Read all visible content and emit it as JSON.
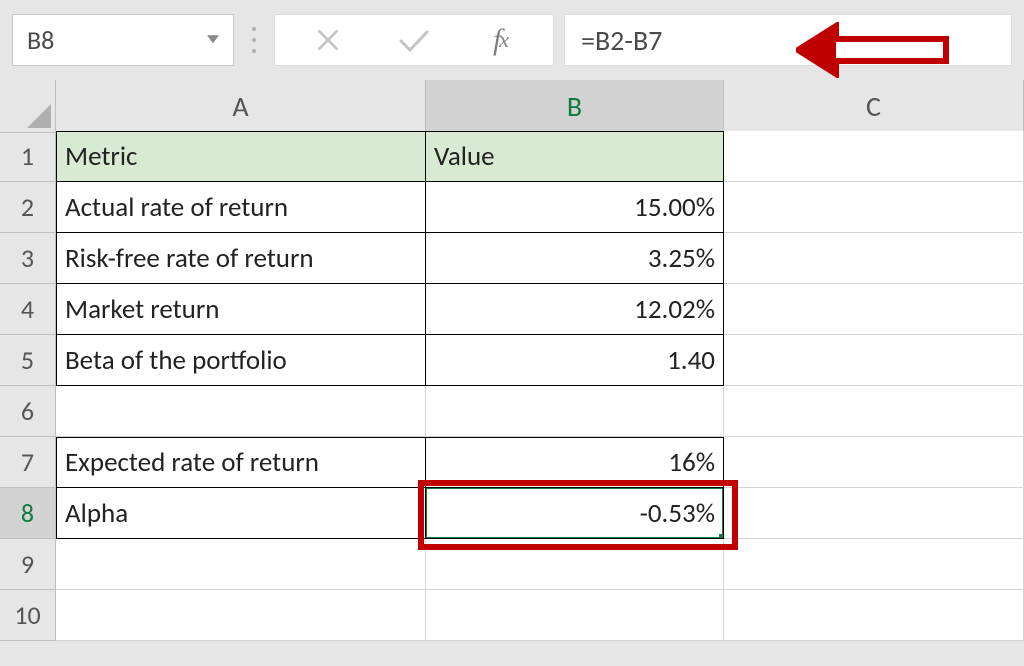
{
  "nameBox": "B8",
  "formula": "=B2-B7",
  "columns": [
    "A",
    "B",
    "C"
  ],
  "rows": [
    1,
    2,
    3,
    4,
    5,
    6,
    7,
    8,
    9,
    10
  ],
  "activeColumn": "B",
  "activeRow": 8,
  "cells": {
    "A1": "Metric",
    "B1": "Value",
    "A2": "Actual rate of return",
    "B2": "15.00%",
    "A3": "Risk-free rate of return",
    "B3": "3.25%",
    "A4": "Market return",
    "B4": "12.02%",
    "A5": "Beta of the portfolio",
    "B5": "1.40",
    "A7": "Expected rate of return",
    "B7": "16%",
    "A8": "Alpha",
    "B8": "-0.53%"
  },
  "chart_data": {
    "type": "table",
    "title": "",
    "columns": [
      "Metric",
      "Value"
    ],
    "rows": [
      [
        "Actual rate of return",
        "15.00%"
      ],
      [
        "Risk-free rate of return",
        "3.25%"
      ],
      [
        "Market return",
        "12.02%"
      ],
      [
        "Beta of the portfolio",
        "1.40"
      ],
      [
        "Expected rate of return",
        "16%"
      ],
      [
        "Alpha",
        "-0.53%"
      ]
    ],
    "formula_shown": "=B2-B7",
    "selected_cell": "B8"
  }
}
